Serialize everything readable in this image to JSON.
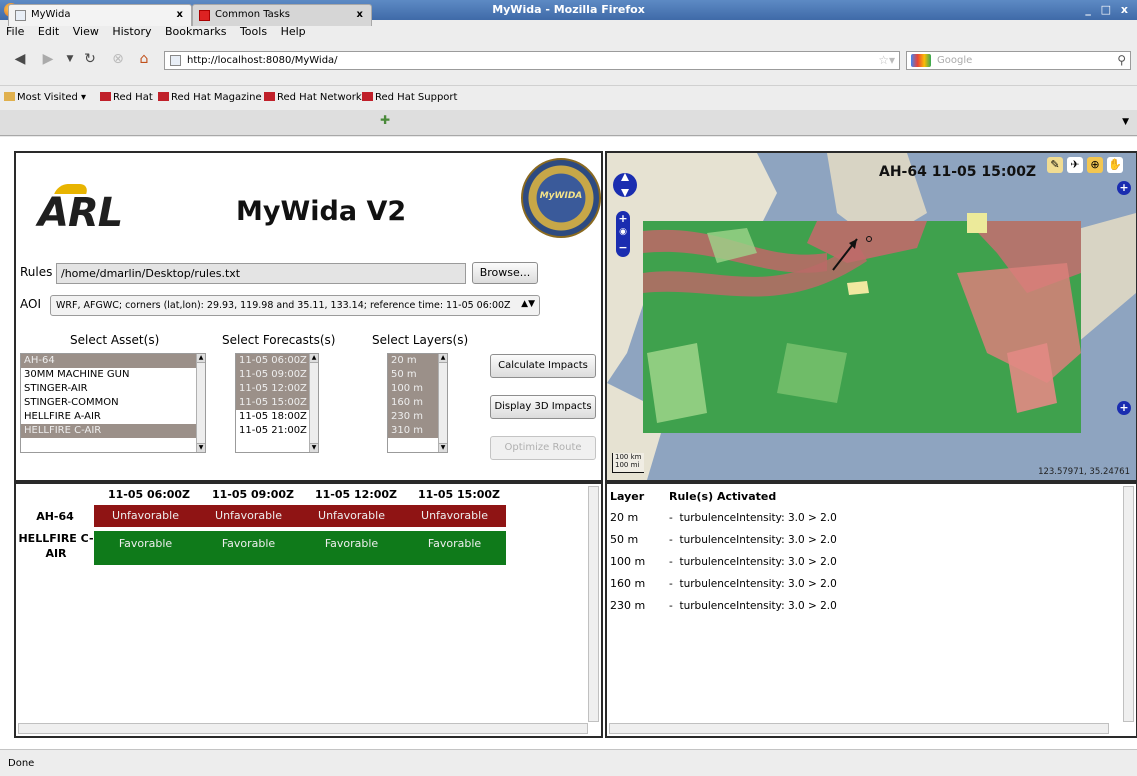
{
  "window": {
    "title": "MyWida - Mozilla Firefox"
  },
  "menu": [
    "File",
    "Edit",
    "View",
    "History",
    "Bookmarks",
    "Tools",
    "Help"
  ],
  "nav": {
    "url": "http://localhost:8080/MyWida/",
    "search_placeholder": "Google"
  },
  "bookmarks": [
    "Most Visited",
    "Red Hat",
    "Red Hat Magazine",
    "Red Hat Network",
    "Red Hat Support"
  ],
  "tabs": [
    {
      "label": "MyWida"
    },
    {
      "label": "Common Tasks"
    }
  ],
  "app": {
    "logo": "ARL",
    "title": "MyWida V2",
    "seal_text": "MyWIDA",
    "rules_label": "Rules",
    "rules_path": "/home/dmarlin/Desktop/rules.txt",
    "browse_label": "Browse...",
    "aoi_label": "AOI",
    "aoi_value": "WRF, AFGWC; corners (lat,lon): 29.93, 119.98 and 35.11, 133.14; reference time: 11-05 06:00Z",
    "assets_label": "Select Asset(s)",
    "forecasts_label": "Select Forecasts(s)",
    "layers_label": "Select Layers(s)",
    "assets": [
      {
        "label": "AH-64",
        "selected": true
      },
      {
        "label": "30MM MACHINE GUN",
        "selected": false
      },
      {
        "label": "STINGER-AIR",
        "selected": false
      },
      {
        "label": "STINGER-COMMON",
        "selected": false
      },
      {
        "label": "HELLFIRE A-AIR",
        "selected": false
      },
      {
        "label": "HELLFIRE C-AIR",
        "selected": true
      }
    ],
    "forecasts": [
      {
        "label": "11-05 06:00Z",
        "selected": true
      },
      {
        "label": "11-05 09:00Z",
        "selected": true
      },
      {
        "label": "11-05 12:00Z",
        "selected": true
      },
      {
        "label": "11-05 15:00Z",
        "selected": true
      },
      {
        "label": "11-05 18:00Z",
        "selected": false
      },
      {
        "label": "11-05 21:00Z",
        "selected": false
      }
    ],
    "layers": [
      {
        "label": "20 m",
        "selected": true
      },
      {
        "label": "50 m",
        "selected": true
      },
      {
        "label": "100 m",
        "selected": true
      },
      {
        "label": "160 m",
        "selected": true
      },
      {
        "label": "230 m",
        "selected": true
      },
      {
        "label": "310 m",
        "selected": true
      }
    ],
    "buttons": {
      "calculate": "Calculate Impacts",
      "display3d": "Display 3D Impacts",
      "optimize": "Optimize Route"
    }
  },
  "map": {
    "title": "AH-64 11-05 15:00Z",
    "coords": "123.57971, 35.24761",
    "scale_km": "100 km",
    "scale_mi": "100 mi"
  },
  "impacts": {
    "times": [
      "11-05 06:00Z",
      "11-05 09:00Z",
      "11-05 12:00Z",
      "11-05 15:00Z"
    ],
    "rows": [
      {
        "asset": "AH-64",
        "values": [
          "Unfavorable",
          "Unfavorable",
          "Unfavorable",
          "Unfavorable"
        ],
        "status": "unfav"
      },
      {
        "asset": "HELLFIRE C-AIR",
        "values": [
          "Favorable",
          "Favorable",
          "Favorable",
          "Favorable"
        ],
        "status": "fav"
      }
    ]
  },
  "rules_activated": {
    "col_layer": "Layer",
    "col_rules": "Rule(s) Activated",
    "rows": [
      {
        "layer": "20 m",
        "rule": "turbulenceIntensity: 3.0 > 2.0"
      },
      {
        "layer": "50 m",
        "rule": "turbulenceIntensity: 3.0 > 2.0"
      },
      {
        "layer": "100 m",
        "rule": "turbulenceIntensity: 3.0 > 2.0"
      },
      {
        "layer": "160 m",
        "rule": "turbulenceIntensity: 3.0 > 2.0"
      },
      {
        "layer": "230 m",
        "rule": "turbulenceIntensity: 3.0 > 2.0"
      }
    ]
  },
  "status": "Done",
  "colors": {
    "unfavorable": "#8f1414",
    "favorable": "#0f7a1a",
    "selection": "#9b9089",
    "titlebar": "#3f6aa8"
  }
}
